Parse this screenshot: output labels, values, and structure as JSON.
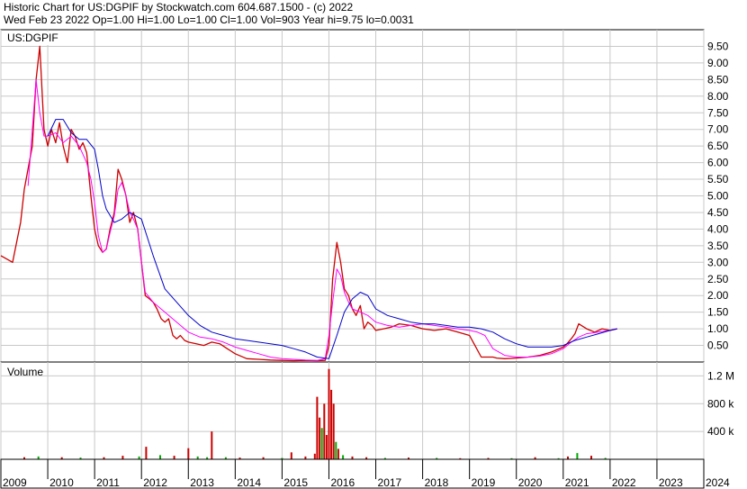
{
  "header": {
    "line1": "Historic Chart for US:DGPIF by Stockwatch.com 604.687.1500 - (c) 2022",
    "line2": "Wed Feb 23 2022   Op=1.00   Hi=1.00   Lo=1.00   Cl=1.00   Vol=903   Year hi=9.75   lo=0.0031"
  },
  "chart_data": [
    {
      "type": "line",
      "title": "US:DGPIF",
      "ylim": [
        0,
        10
      ],
      "yticks": [
        "0.50",
        "1.00",
        "1.50",
        "2.00",
        "2.50",
        "3.00",
        "3.50",
        "4.00",
        "4.50",
        "5.00",
        "5.50",
        "6.00",
        "6.50",
        "7.00",
        "7.50",
        "8.00",
        "8.50",
        "9.00",
        "9.50"
      ],
      "grid": true,
      "series": [
        {
          "name": "",
          "color": "#cc0000",
          "x": [
            2009.0,
            2009.25,
            2009.42,
            2009.5,
            2009.67,
            2009.75,
            2009.83,
            2009.92,
            2010.0,
            2010.08,
            2010.17,
            2010.25,
            2010.33,
            2010.42,
            2010.5,
            2010.58,
            2010.67,
            2010.75,
            2010.83,
            2010.92,
            2011.0,
            2011.08,
            2011.17,
            2011.25,
            2011.33,
            2011.42,
            2011.5,
            2011.58,
            2011.67,
            2011.75,
            2011.83,
            2011.92,
            2012.0,
            2012.08,
            2012.17,
            2012.25,
            2012.33,
            2012.42,
            2012.5,
            2012.58,
            2012.67,
            2012.75,
            2012.83,
            2012.92,
            2013.0,
            2013.17,
            2013.33,
            2013.5,
            2013.67,
            2013.83,
            2014.0,
            2014.25,
            2014.5,
            2014.75,
            2015.0,
            2015.25,
            2015.5,
            2015.75,
            2015.92,
            2016.0,
            2016.08,
            2016.17,
            2016.25,
            2016.33,
            2016.42,
            2016.5,
            2016.58,
            2016.67,
            2016.75,
            2016.83,
            2016.92,
            2017.0,
            2017.17,
            2017.33,
            2017.5,
            2017.75,
            2018.0,
            2018.25,
            2018.5,
            2018.75,
            2019.0,
            2019.25,
            2019.5,
            2019.58,
            2019.75,
            2020.0,
            2020.25,
            2020.5,
            2020.75,
            2021.0,
            2021.08,
            2021.17,
            2021.25,
            2021.33,
            2021.5,
            2021.67,
            2021.83,
            2022.0,
            2022.15
          ],
          "y": [
            3.2,
            3.0,
            4.2,
            5.2,
            6.5,
            8.5,
            9.5,
            7.0,
            6.5,
            7.0,
            6.6,
            7.2,
            6.5,
            6.0,
            7.0,
            6.8,
            6.4,
            6.6,
            6.3,
            5.0,
            4.0,
            3.5,
            3.3,
            3.4,
            4.0,
            4.5,
            5.8,
            5.5,
            5.0,
            4.2,
            4.5,
            4.0,
            3.0,
            2.0,
            1.9,
            1.8,
            1.6,
            1.3,
            1.2,
            1.3,
            0.8,
            0.7,
            0.8,
            0.65,
            0.6,
            0.55,
            0.5,
            0.6,
            0.55,
            0.4,
            0.25,
            0.1,
            0.08,
            0.06,
            0.05,
            0.04,
            0.05,
            0.04,
            0.05,
            0.5,
            2.5,
            3.6,
            3.0,
            2.2,
            2.0,
            1.6,
            1.4,
            1.7,
            1.0,
            1.2,
            1.1,
            0.95,
            1.0,
            1.05,
            1.15,
            1.1,
            1.0,
            0.95,
            1.0,
            0.9,
            0.8,
            0.15,
            0.15,
            0.12,
            0.1,
            0.12,
            0.15,
            0.2,
            0.3,
            0.45,
            0.55,
            0.7,
            0.85,
            1.15,
            1.0,
            0.9,
            1.0,
            0.95,
            1.0
          ]
        },
        {
          "name": "",
          "color": "#ff00ff",
          "x": [
            2009.58,
            2009.67,
            2009.75,
            2009.83,
            2009.92,
            2010.0,
            2010.17,
            2010.33,
            2010.5,
            2010.67,
            2010.83,
            2010.92,
            2011.0,
            2011.08,
            2011.17,
            2011.25,
            2011.33,
            2011.42,
            2011.5,
            2011.58,
            2011.67,
            2011.75,
            2011.83,
            2011.92,
            2012.0,
            2012.08,
            2012.25,
            2012.5,
            2012.75,
            2013.0,
            2013.25,
            2013.5,
            2013.75,
            2014.0,
            2014.25,
            2014.5,
            2014.75,
            2015.0,
            2015.25,
            2015.5,
            2015.75,
            2015.92,
            2016.0,
            2016.08,
            2016.17,
            2016.25,
            2016.33,
            2016.42,
            2016.5,
            2016.67,
            2016.83,
            2017.0,
            2017.25,
            2017.5,
            2017.75,
            2018.0,
            2018.25,
            2018.5,
            2018.75,
            2019.0,
            2019.17,
            2019.33,
            2019.5,
            2019.75,
            2020.0,
            2020.25,
            2020.5,
            2020.75,
            2021.0,
            2021.17,
            2021.33,
            2021.5,
            2021.75,
            2022.0,
            2022.15
          ],
          "y": [
            5.3,
            7.0,
            8.5,
            7.5,
            6.8,
            6.8,
            6.9,
            6.6,
            6.8,
            6.5,
            6.0,
            5.5,
            4.8,
            3.8,
            3.3,
            3.4,
            3.9,
            4.4,
            5.2,
            5.4,
            5.0,
            4.5,
            4.3,
            4.0,
            3.0,
            2.1,
            1.8,
            1.5,
            1.2,
            0.9,
            0.75,
            0.7,
            0.6,
            0.45,
            0.35,
            0.25,
            0.15,
            0.1,
            0.08,
            0.06,
            0.05,
            0.1,
            0.8,
            1.8,
            2.8,
            2.6,
            2.1,
            1.8,
            1.6,
            1.5,
            1.4,
            1.2,
            1.1,
            1.05,
            1.1,
            1.15,
            1.1,
            1.05,
            1.0,
            0.95,
            0.9,
            0.8,
            0.4,
            0.2,
            0.15,
            0.15,
            0.18,
            0.25,
            0.4,
            0.6,
            0.75,
            0.85,
            0.9,
            0.95,
            1.0
          ]
        },
        {
          "name": "",
          "color": "#0000cc",
          "x": [
            2010.0,
            2010.17,
            2010.33,
            2010.5,
            2010.67,
            2010.83,
            2011.0,
            2011.08,
            2011.17,
            2011.25,
            2011.42,
            2011.58,
            2011.75,
            2012.0,
            2012.25,
            2012.5,
            2012.75,
            2013.0,
            2013.25,
            2013.5,
            2013.75,
            2014.0,
            2014.25,
            2014.5,
            2014.75,
            2015.0,
            2015.25,
            2015.5,
            2015.75,
            2016.0,
            2016.17,
            2016.33,
            2016.5,
            2016.67,
            2016.83,
            2017.0,
            2017.25,
            2017.5,
            2017.75,
            2018.0,
            2018.25,
            2018.5,
            2018.75,
            2019.0,
            2019.25,
            2019.5,
            2019.75,
            2020.0,
            2020.25,
            2020.5,
            2020.75,
            2021.0,
            2021.25,
            2021.5,
            2021.75,
            2022.0,
            2022.15
          ],
          "y": [
            6.8,
            7.3,
            7.3,
            6.9,
            6.7,
            6.7,
            6.4,
            5.8,
            5.0,
            4.6,
            4.2,
            4.3,
            4.5,
            4.3,
            3.2,
            2.2,
            1.8,
            1.4,
            1.1,
            0.9,
            0.8,
            0.7,
            0.65,
            0.6,
            0.55,
            0.5,
            0.4,
            0.3,
            0.15,
            0.1,
            0.8,
            1.5,
            1.9,
            2.1,
            2.0,
            1.6,
            1.4,
            1.3,
            1.2,
            1.15,
            1.15,
            1.1,
            1.05,
            1.05,
            1.0,
            0.9,
            0.7,
            0.55,
            0.45,
            0.45,
            0.45,
            0.5,
            0.65,
            0.75,
            0.85,
            0.95,
            1.0
          ]
        }
      ]
    },
    {
      "type": "bar",
      "title": "Volume",
      "ylim": [
        0,
        1400000
      ],
      "yticks": [
        "400 k",
        "800 k",
        "1.2 M"
      ],
      "grid": true,
      "categories": [
        "2009",
        "2010",
        "2011",
        "2012",
        "2013",
        "2014",
        "2015",
        "2016",
        "2017",
        "2018",
        "2019",
        "2020",
        "2021",
        "2022",
        "2023",
        "2024"
      ],
      "x_ticks": [
        2009,
        2010,
        2011,
        2012,
        2013,
        2014,
        2015,
        2016,
        2017,
        2018,
        2019,
        2020,
        2021,
        2022,
        2023,
        2024
      ],
      "x_range": [
        2009,
        2024
      ],
      "series": [
        {
          "name": "",
          "colors": {
            "up": "#00aa00",
            "down": "#cc0000"
          },
          "x": [
            2009.5,
            2009.8,
            2010.3,
            2010.7,
            2011.2,
            2011.6,
            2011.95,
            2012.1,
            2012.4,
            2012.7,
            2013.0,
            2013.2,
            2013.4,
            2013.5,
            2013.8,
            2014.1,
            2014.6,
            2015.0,
            2015.2,
            2015.5,
            2015.7,
            2015.75,
            2015.8,
            2015.85,
            2015.9,
            2015.95,
            2016.0,
            2016.05,
            2016.1,
            2016.15,
            2016.2,
            2016.3,
            2016.5,
            2016.8,
            2017.2,
            2017.7,
            2018.3,
            2018.8,
            2019.4,
            2019.9,
            2020.4,
            2020.9,
            2021.1,
            2021.3,
            2021.6,
            2021.9
          ],
          "y": [
            30000,
            40000,
            30000,
            25000,
            30000,
            50000,
            40000,
            180000,
            60000,
            50000,
            160000,
            40000,
            30000,
            400000,
            30000,
            25000,
            30000,
            20000,
            100000,
            40000,
            80000,
            900000,
            600000,
            450000,
            800000,
            350000,
            1300000,
            1000000,
            800000,
            250000,
            150000,
            60000,
            40000,
            30000,
            20000,
            25000,
            20000,
            15000,
            20000,
            15000,
            30000,
            15000,
            40000,
            90000,
            50000,
            20000
          ],
          "dir": [
            "down",
            "up",
            "down",
            "up",
            "down",
            "down",
            "up",
            "down",
            "up",
            "down",
            "down",
            "up",
            "up",
            "down",
            "up",
            "down",
            "down",
            "up",
            "down",
            "down",
            "down",
            "down",
            "down",
            "up",
            "down",
            "down",
            "down",
            "down",
            "down",
            "up",
            "down",
            "up",
            "down",
            "down",
            "up",
            "down",
            "up",
            "down",
            "down",
            "up",
            "down",
            "up",
            "down",
            "up",
            "down",
            "up"
          ]
        }
      ]
    }
  ]
}
